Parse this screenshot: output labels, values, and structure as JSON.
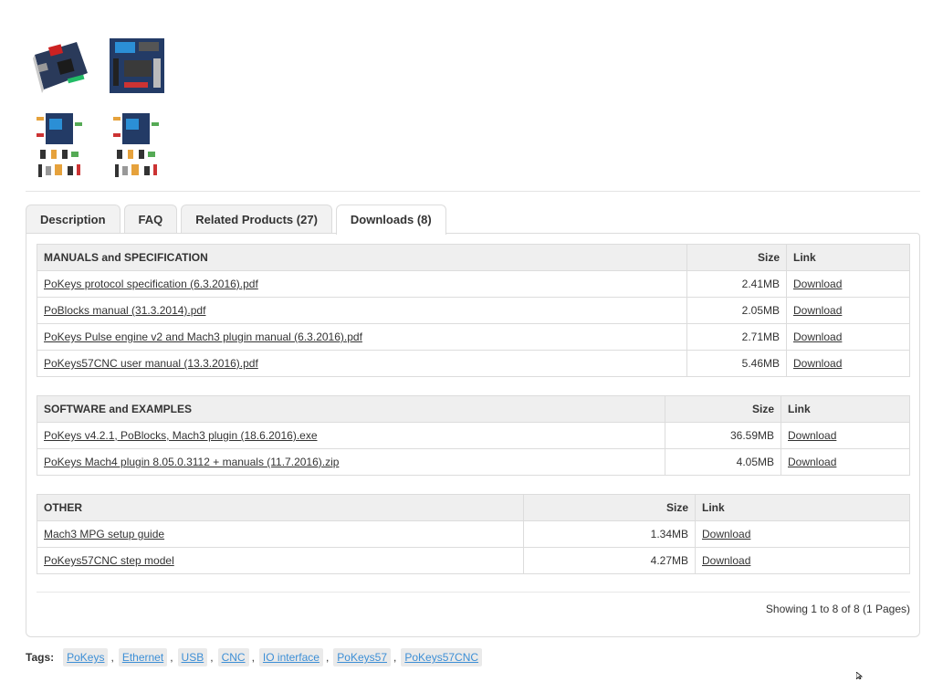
{
  "tabs": [
    {
      "label": "Description",
      "active": false
    },
    {
      "label": "FAQ",
      "active": false
    },
    {
      "label": "Related Products (27)",
      "active": false
    },
    {
      "label": "Downloads (8)",
      "active": true
    }
  ],
  "tables": [
    {
      "header": "MANUALS and SPECIFICATION",
      "size_header": "Size",
      "link_header": "Link",
      "rows": [
        {
          "name": "PoKeys protocol specification (6.3.2016).pdf",
          "size": "2.41MB",
          "link": "Download"
        },
        {
          "name": "PoBlocks manual (31.3.2014).pdf",
          "size": "2.05MB",
          "link": "Download"
        },
        {
          "name": "PoKeys Pulse engine v2 and Mach3 plugin manual (6.3.2016).pdf",
          "size": "2.71MB",
          "link": "Download"
        },
        {
          "name": "PoKeys57CNC user manual (13.3.2016).pdf",
          "size": "5.46MB",
          "link": "Download"
        }
      ]
    },
    {
      "header": "SOFTWARE and EXAMPLES",
      "size_header": "Size",
      "link_header": "Link",
      "rows": [
        {
          "name": "PoKeys v4.2.1, PoBlocks, Mach3 plugin (18.6.2016).exe",
          "size": "36.59MB",
          "link": "Download"
        },
        {
          "name": "PoKeys Mach4 plugin 8.05.0.3112 + manuals (11.7.2016).zip",
          "size": "4.05MB",
          "link": "Download"
        }
      ]
    },
    {
      "header": "OTHER",
      "size_header": "Size",
      "link_header": "Link",
      "rows": [
        {
          "name": "Mach3 MPG setup guide",
          "size": "1.34MB",
          "link": "Download"
        },
        {
          "name": "PoKeys57CNC step model",
          "size": "4.27MB",
          "link": "Download"
        }
      ]
    }
  ],
  "pagination": {
    "text": "Showing 1 to 8 of 8 (1 Pages)"
  },
  "tags": {
    "label": "Tags:",
    "items": [
      "PoKeys",
      "Ethernet",
      "USB",
      "CNC",
      "IO interface",
      "PoKeys57",
      "PoKeys57CNC"
    ],
    "separator": ","
  },
  "colors": {
    "tag_link": "#3d8fd6",
    "table_header_bg": "#efefef",
    "border": "#dcdcdc"
  }
}
